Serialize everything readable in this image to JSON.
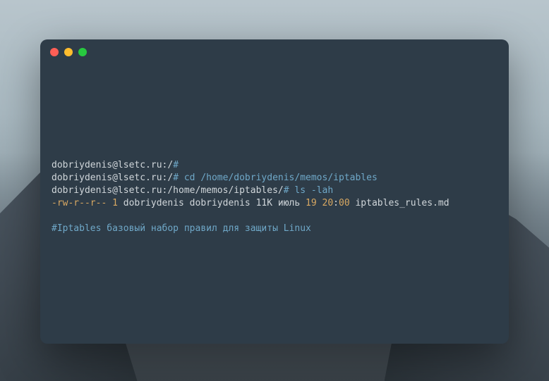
{
  "terminal": {
    "lines": {
      "line1": {
        "prompt": "dobriydenis@lsetc.ru:/",
        "hash": "#"
      },
      "line2": {
        "prompt": "dobriydenis@lsetc.ru:/",
        "hash": "#",
        "cmd": " cd /home/dobriydenis/memos/iptables"
      },
      "line3": {
        "prompt": "dobriydenis@lsetc.ru:/home/memos/iptables/",
        "hash": "#",
        "cmd": " ls -lah"
      },
      "line4": {
        "perm": "-rw-r--r-- ",
        "num1": "1",
        "mid": " dobriydenis dobriydenis 11K июль ",
        "num2": "19",
        "sp1": " ",
        "num3": "20",
        "colon": ":",
        "num4": "00",
        "tail": " iptables_rules.md"
      },
      "footer": "#Iptables базовый набор правил для защиты Linux"
    }
  }
}
